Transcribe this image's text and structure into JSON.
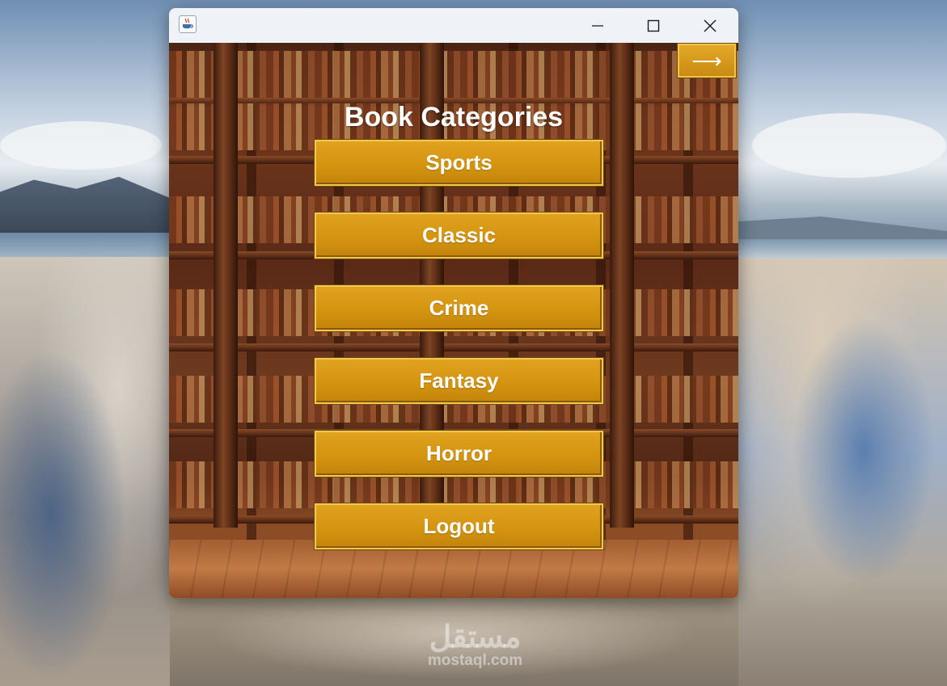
{
  "window": {
    "app_icon": "java-coffee-cup-icon",
    "controls": {
      "minimize_icon": "minimize-icon",
      "maximize_icon": "maximize-icon",
      "close_icon": "close-icon"
    }
  },
  "header": {
    "title": "Book Categories",
    "next_label": "⟶"
  },
  "categories": [
    {
      "label": "Sports"
    },
    {
      "label": "Classic"
    },
    {
      "label": "Crime"
    },
    {
      "label": "Fantasy"
    },
    {
      "label": "Horror"
    }
  ],
  "logout_label": "Logout",
  "watermark": {
    "arabic": "مستقل",
    "latin": "mostaql.com"
  },
  "colors": {
    "button_gold": "#d3930f",
    "button_border": "#f2c851",
    "title_text": "#ffffff",
    "titlebar": "#eff3f8"
  }
}
